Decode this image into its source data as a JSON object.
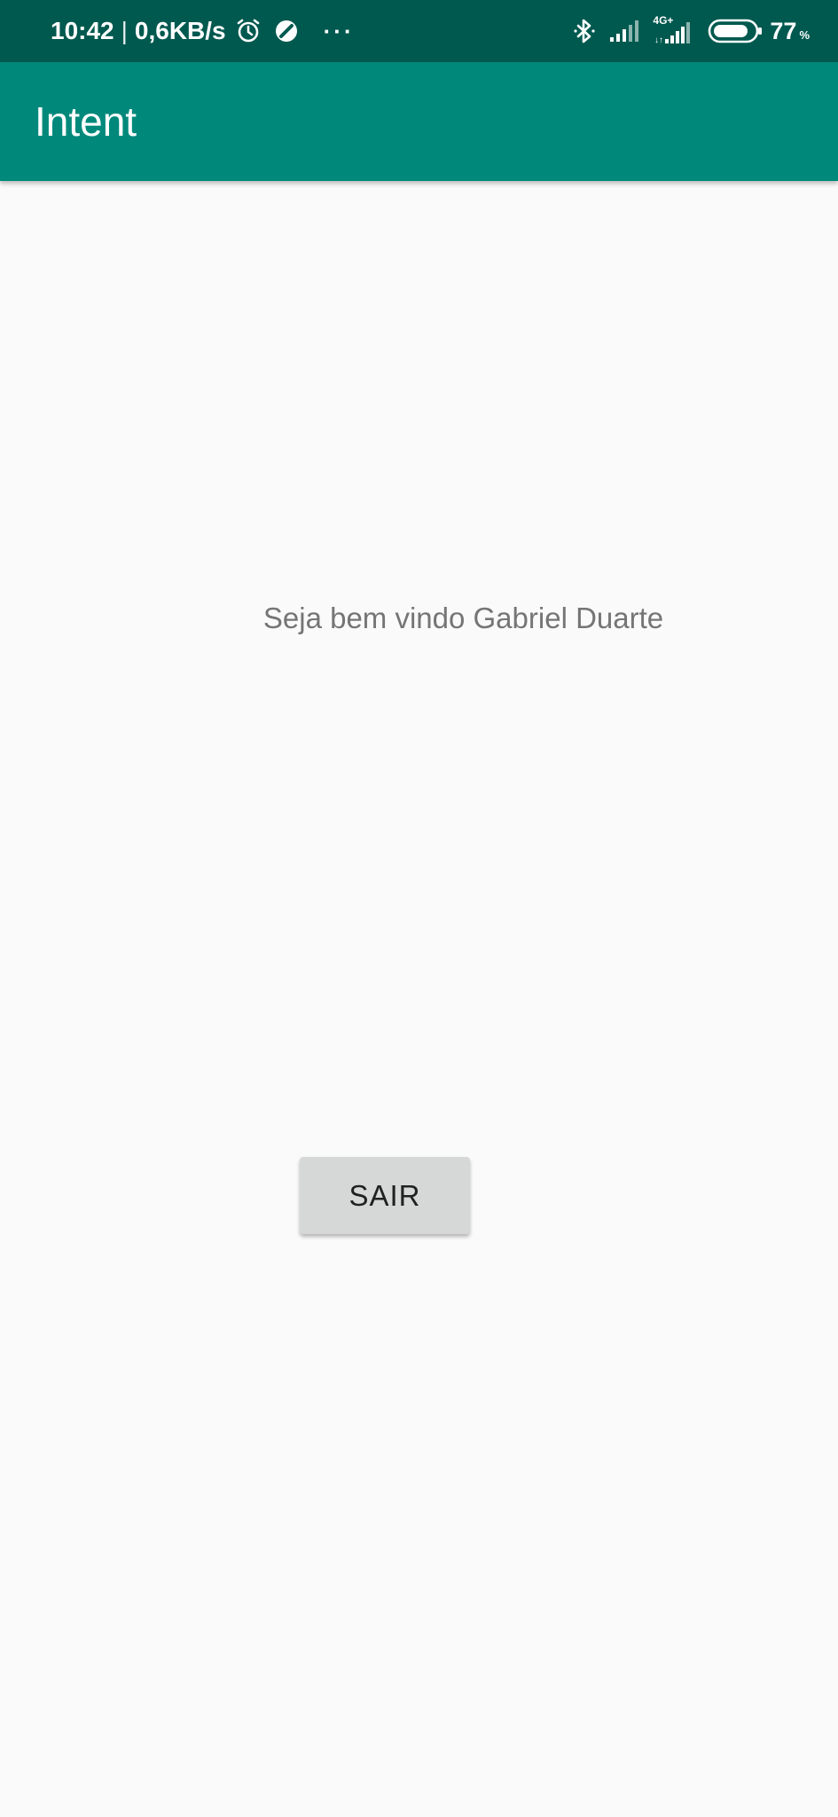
{
  "status_bar": {
    "time": "10:42",
    "separator": "|",
    "net_speed": "0,6KB/s",
    "more": "···",
    "network_type": "4G+",
    "battery_percent": "77",
    "battery_unit": "%",
    "icons": [
      "alarm-icon",
      "dnd-icon",
      "bluetooth-icon",
      "signal-icon",
      "signal-4g-icon",
      "battery-icon"
    ]
  },
  "app_bar": {
    "title": "Intent"
  },
  "main": {
    "welcome_text": "Seja bem vindo Gabriel Duarte",
    "exit_button_label": "SAIR"
  },
  "colors": {
    "status_bar_bg": "#00594f",
    "app_bar_bg": "#00897b",
    "page_bg": "#fafafa",
    "button_bg": "#d6d7d7",
    "text_secondary": "#757575"
  }
}
